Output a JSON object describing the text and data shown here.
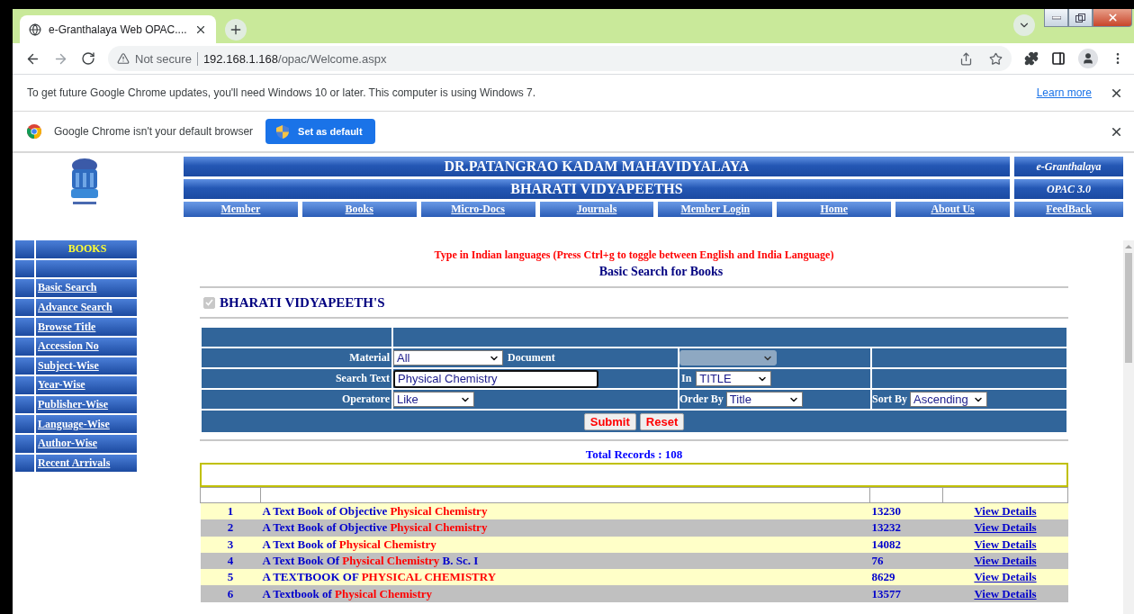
{
  "browser": {
    "tab": {
      "title": "e-Granthalaya Web OPAC...."
    },
    "address": {
      "security": "Not secure",
      "host": "192.168.1.168",
      "path": "/opac/Welcome.aspx"
    }
  },
  "infobars": [
    {
      "kind": "update",
      "text": "To get future Google Chrome updates, you'll need Windows 10 or later. This computer is using Windows 7.",
      "link": "Learn more"
    },
    {
      "kind": "default",
      "text": "Google Chrome isn't your default browser",
      "button": "Set as default"
    }
  ],
  "header": {
    "title": "DR.PATANGRAO KADAM MAHAVIDYALAYA",
    "subtitle": "BHARATI VIDYAPEETHS",
    "brand": "e-Granthalaya",
    "version": "OPAC 3.0",
    "nav": [
      "Member",
      "Books",
      "Micro-Docs",
      "Journals",
      "Member Login",
      "Home",
      "About Us",
      "FeedBack"
    ]
  },
  "sidebar": {
    "heading": "BOOKS",
    "items": [
      "Basic Search",
      "Advance Search",
      "Browse Title",
      "Accession No",
      "Subject-Wise",
      "Year-Wise",
      "Publisher-Wise",
      "Language-Wise",
      "Author-Wise",
      "Recent Arrivals"
    ]
  },
  "search": {
    "notice": "Type in Indian languages (Press Ctrl+g to toggle between English and India Language)",
    "heading": "Basic Search for Books",
    "institution": {
      "label": "BHARATI VIDYAPEETH'S",
      "checked": true,
      "disabled": true
    },
    "material": {
      "label": "Material",
      "value": "All"
    },
    "document": {
      "label": "Document",
      "disabled": true
    },
    "search_text": {
      "label": "Search  Text",
      "value": "Physical Chemistry"
    },
    "search_in": {
      "label": "In",
      "value": "TITLE"
    },
    "operator": {
      "label": "Operatore",
      "value": "Like"
    },
    "order_by": {
      "label": "Order By",
      "value": "Title"
    },
    "sort_by": {
      "label": "Sort By",
      "value": "Ascending"
    },
    "buttons": [
      "Submit",
      "Reset"
    ]
  },
  "results": {
    "total": "Total Records : 108",
    "rows": [
      {
        "number": "1",
        "title_parts": [
          {
            "text": "A Text Book of Objective ",
            "highlight": false
          },
          {
            "text": "Physical Chemistry",
            "highlight": true
          }
        ],
        "accession": "13230",
        "action": "View Details"
      },
      {
        "number": "2",
        "title_parts": [
          {
            "text": "A Text Book of Objective ",
            "highlight": false
          },
          {
            "text": "Physical Chemistry",
            "highlight": true
          }
        ],
        "accession": "13232",
        "action": "View Details"
      },
      {
        "number": "3",
        "title_parts": [
          {
            "text": "A Text Book of ",
            "highlight": false
          },
          {
            "text": "Physical Chemistry",
            "highlight": true
          }
        ],
        "accession": "14082",
        "action": "View Details"
      },
      {
        "number": "4",
        "title_parts": [
          {
            "text": "A Text Book Of ",
            "highlight": false
          },
          {
            "text": "Physical Chemistry",
            "highlight": true
          },
          {
            "text": " B. Sc. I",
            "highlight": false
          }
        ],
        "accession": "76",
        "action": "View Details"
      },
      {
        "number": "5",
        "title_parts": [
          {
            "text": "A TEXTBOOK OF ",
            "highlight": false
          },
          {
            "text": "PHYSICAL CHEMISTRY",
            "highlight": true
          }
        ],
        "accession": "8629",
        "action": "View Details"
      },
      {
        "number": "6",
        "title_parts": [
          {
            "text": "A Textbook of ",
            "highlight": false
          },
          {
            "text": "Physical Chemistry",
            "highlight": true
          }
        ],
        "accession": "13577",
        "action": "View Details"
      }
    ]
  }
}
